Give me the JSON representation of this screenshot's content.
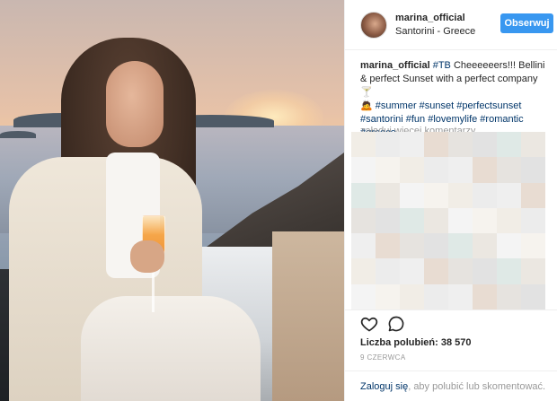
{
  "post": {
    "username": "marina_official",
    "location": "Santorini - Greece",
    "follow_label": "Obserwuj"
  },
  "caption": {
    "username": "marina_official",
    "tb_tag": "#TB",
    "text_1": " Cheeeeeers!!! Bellini & perfect Sunset with a perfect company ",
    "cheers_emoji": "🍸",
    "emoji_person": "🙇",
    "tags": "#summer #sunset #perfectsunset #santorini #fun #lovemylife #romantic #greece"
  },
  "comments": {
    "load_more": "załaduj więcej komentarzy"
  },
  "icons": {
    "like": "heart-icon",
    "comment": "comment-icon"
  },
  "stats": {
    "likes": "Liczba polubień: 38 570",
    "date": "9 CZERWCA"
  },
  "footer": {
    "login_link": "Zaloguj się",
    "login_text": ", aby polubić lub skomentować."
  },
  "colors": {
    "accent": "#3897f0",
    "link": "#003569",
    "muted": "#999999",
    "text": "#262626"
  }
}
